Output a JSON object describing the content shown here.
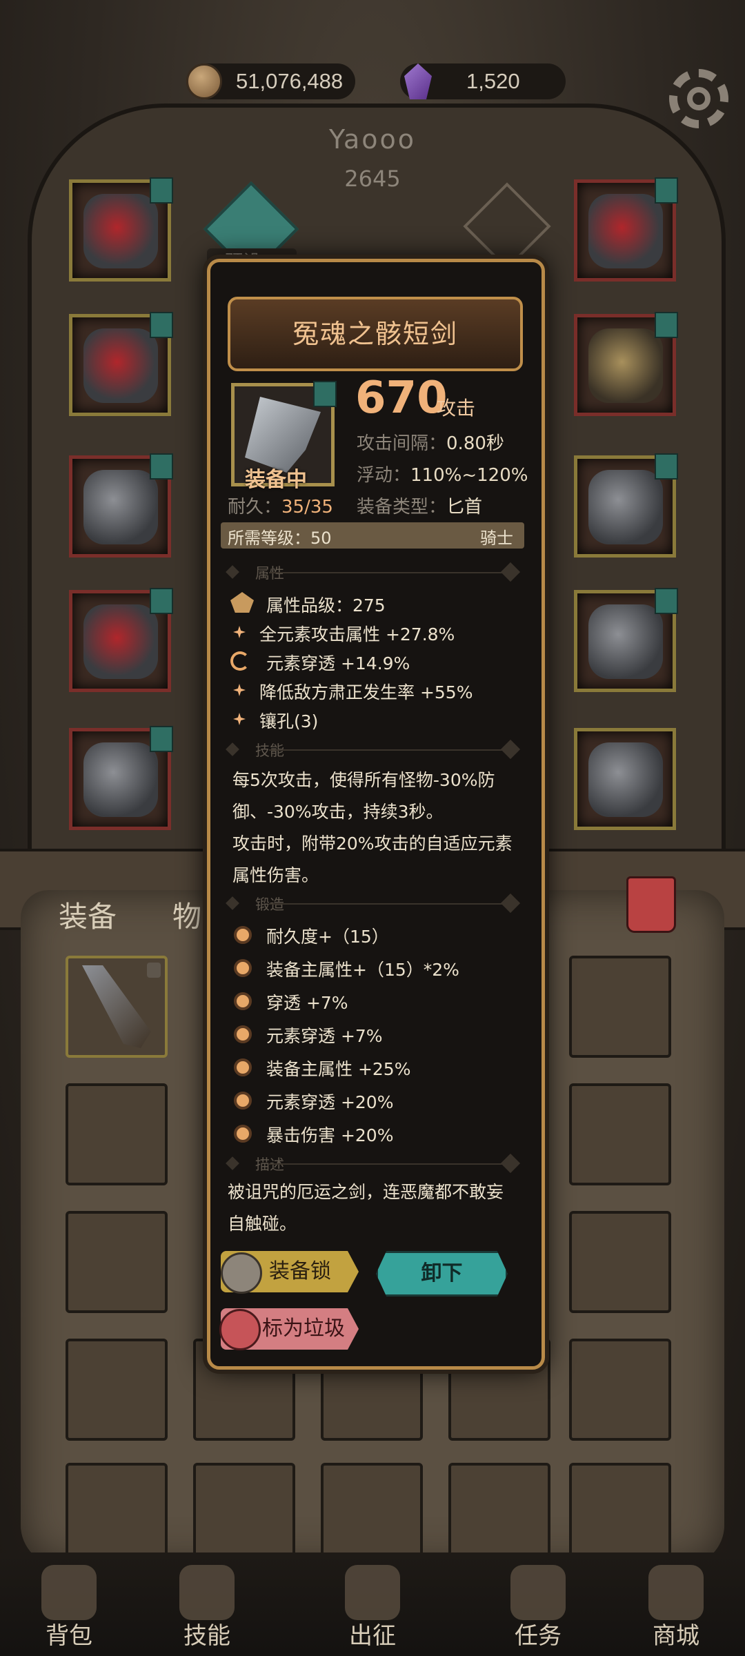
{
  "currency": {
    "gold": "51,076,488",
    "gems": "1,520"
  },
  "player": {
    "name": "Yaooo",
    "power": "2645"
  },
  "preset": {
    "label": "预设一"
  },
  "item": {
    "name": "冤魂之骸短剑",
    "equipped_label": "装备中",
    "damage": "670",
    "damage_unit": "攻击",
    "attack_interval_label": "攻击间隔：",
    "attack_interval": "0.80秒",
    "float_label": "浮动：",
    "float": "110%~120%",
    "durability_label": "耐久：",
    "durability": "35/35",
    "type_label": "装备类型：",
    "type": "匕首",
    "required_level_label": "所需等级：",
    "required_level": "50",
    "class": "骑士"
  },
  "sections": {
    "attributes": "属性",
    "skills": "技能",
    "forging": "锻造",
    "description": "描述"
  },
  "attributes": [
    "属性品级：275",
    "全元素攻击属性 +27.8%",
    "元素穿透 +14.9%",
    "降低敌方肃正发生率 +55%",
    "镶孔(3)"
  ],
  "skill_text": "每5次攻击，使得所有怪物-30%防御、-30%攻击，持续3秒。\n攻击时，附带20%攻击的自适应元素属性伤害。",
  "skill_lines": [
    "每5次攻击，使得所有怪物-30%防",
    "御、-30%攻击，持续3秒。",
    "攻击时，附带20%攻击的自适应元素",
    "属性伤害。"
  ],
  "forging": [
    "耐久度+（15）",
    "装备主属性+（15）*2%",
    "穿透 +7%",
    "元素穿透 +7%",
    "装备主属性 +25%",
    "元素穿透 +20%",
    "暴击伤害 +20%"
  ],
  "description_lines": [
    "被诅咒的厄运之剑，连恶魔都不敢妄",
    "自触碰。"
  ],
  "buttons": {
    "lock": "装备锁",
    "unequip": "卸下",
    "junk": "标为垃圾"
  },
  "bag_tabs": {
    "equipment": "装备",
    "items": "物品"
  },
  "nav": [
    "背包",
    "技能",
    "出征",
    "任务",
    "商城"
  ],
  "colors": {
    "accent_gold": "#f0b27a",
    "teal": "#36a29a",
    "frame": "#b88a48"
  }
}
